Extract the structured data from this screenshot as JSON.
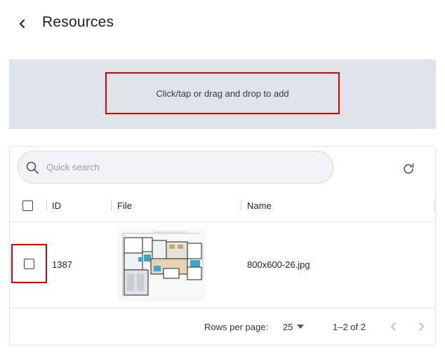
{
  "header": {
    "title": "Resources",
    "back_icon": "chevron-left-icon"
  },
  "dropzone": {
    "text": "Click/tap or drag and drop to add"
  },
  "search": {
    "placeholder": "Quick search",
    "value": "",
    "icon": "search-icon"
  },
  "toolbar": {
    "refresh_icon": "refresh-icon"
  },
  "table": {
    "columns": [
      "ID",
      "File",
      "Name"
    ],
    "rows": [
      {
        "id": "1387",
        "file_icon": "floor-plan-thumbnail",
        "name": "800x600-26.jpg"
      }
    ]
  },
  "footer": {
    "rows_per_page_label": "Rows per page:",
    "rows_per_page_value": "25",
    "range": "1–2 of 2"
  },
  "colors": {
    "highlight": "#e00000",
    "dropzone_bg": "#dfe3ea",
    "search_bg": "#f1f3f6"
  }
}
